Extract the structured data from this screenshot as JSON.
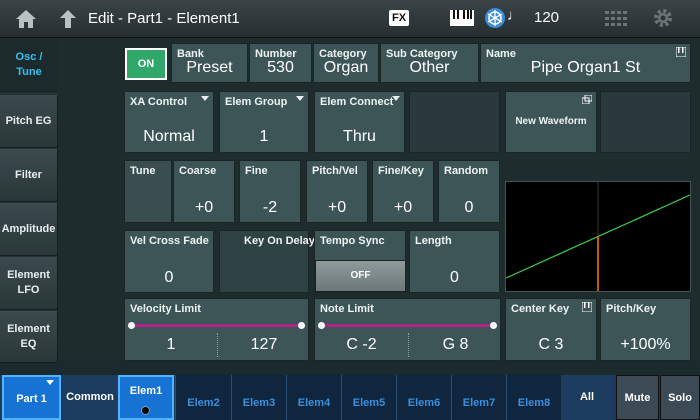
{
  "header": {
    "title": "Edit - Part1 - Element1",
    "fx_label": "FX",
    "note_symbol": "♩",
    "tempo": "120"
  },
  "sidebar": {
    "items": [
      {
        "label": "Osc /\nTune",
        "active": true
      },
      {
        "label": "Pitch EG",
        "active": false
      },
      {
        "label": "Filter",
        "active": false
      },
      {
        "label": "Amplitude",
        "active": false
      },
      {
        "label": "Element\nLFO",
        "active": false
      },
      {
        "label": "Element\nEQ",
        "active": false
      }
    ]
  },
  "osc": {
    "on_label": "ON",
    "bank": {
      "label": "Bank",
      "value": "Preset"
    },
    "number": {
      "label": "Number",
      "value": "530"
    },
    "category": {
      "label": "Category",
      "value": "Organ"
    },
    "sub_category": {
      "label": "Sub Category",
      "value": "Other"
    },
    "name": {
      "label": "Name",
      "value": "Pipe Organ1 St"
    },
    "xa_control": {
      "label": "XA Control",
      "value": "Normal"
    },
    "elem_group": {
      "label": "Elem Group",
      "value": "1"
    },
    "elem_connect": {
      "label": "Elem Connect",
      "value": "Thru"
    },
    "new_waveform": {
      "label": "New Waveform"
    }
  },
  "tune": {
    "label": "Tune",
    "coarse": {
      "label": "Coarse",
      "value": "+0"
    },
    "fine": {
      "label": "Fine",
      "value": "-2"
    },
    "pitch_vel": {
      "label": "Pitch/Vel",
      "value": "+0"
    },
    "fine_key": {
      "label": "Fine/Key",
      "value": "+0"
    },
    "random": {
      "label": "Random",
      "value": "0"
    },
    "vel_cross_fade": {
      "label": "Vel Cross Fade",
      "value": "0"
    },
    "key_on_delay": {
      "label": "Key On Delay"
    },
    "tempo_sync": {
      "label": "Tempo Sync",
      "value": "OFF"
    },
    "length": {
      "label": "Length",
      "value": "0"
    }
  },
  "limits": {
    "velocity_limit": {
      "label": "Velocity Limit",
      "low": "1",
      "high": "127"
    },
    "note_limit": {
      "label": "Note Limit",
      "low": "C -2",
      "high": "G 8"
    },
    "center_key": {
      "label": "Center Key",
      "value": "C 3"
    },
    "pitch_key": {
      "label": "Pitch/Key",
      "value": "+100%"
    }
  },
  "graph": {
    "line_color": "#3ad24a",
    "marker_color": "#ff7a00",
    "pitch_key_percent": 100
  },
  "bottom": {
    "part": "Part 1",
    "common": "Common",
    "elements": [
      "Elem1",
      "Elem2",
      "Elem3",
      "Elem4",
      "Elem5",
      "Elem6",
      "Elem7",
      "Elem8"
    ],
    "active_element": "Elem1",
    "all": "All",
    "mute": "Mute",
    "solo": "Solo"
  },
  "colors": {
    "accent_blue": "#1673d4",
    "on_green": "#2fa86a",
    "limit_bar": "#b0228c",
    "sidebar_active_text": "#36c0f0"
  }
}
